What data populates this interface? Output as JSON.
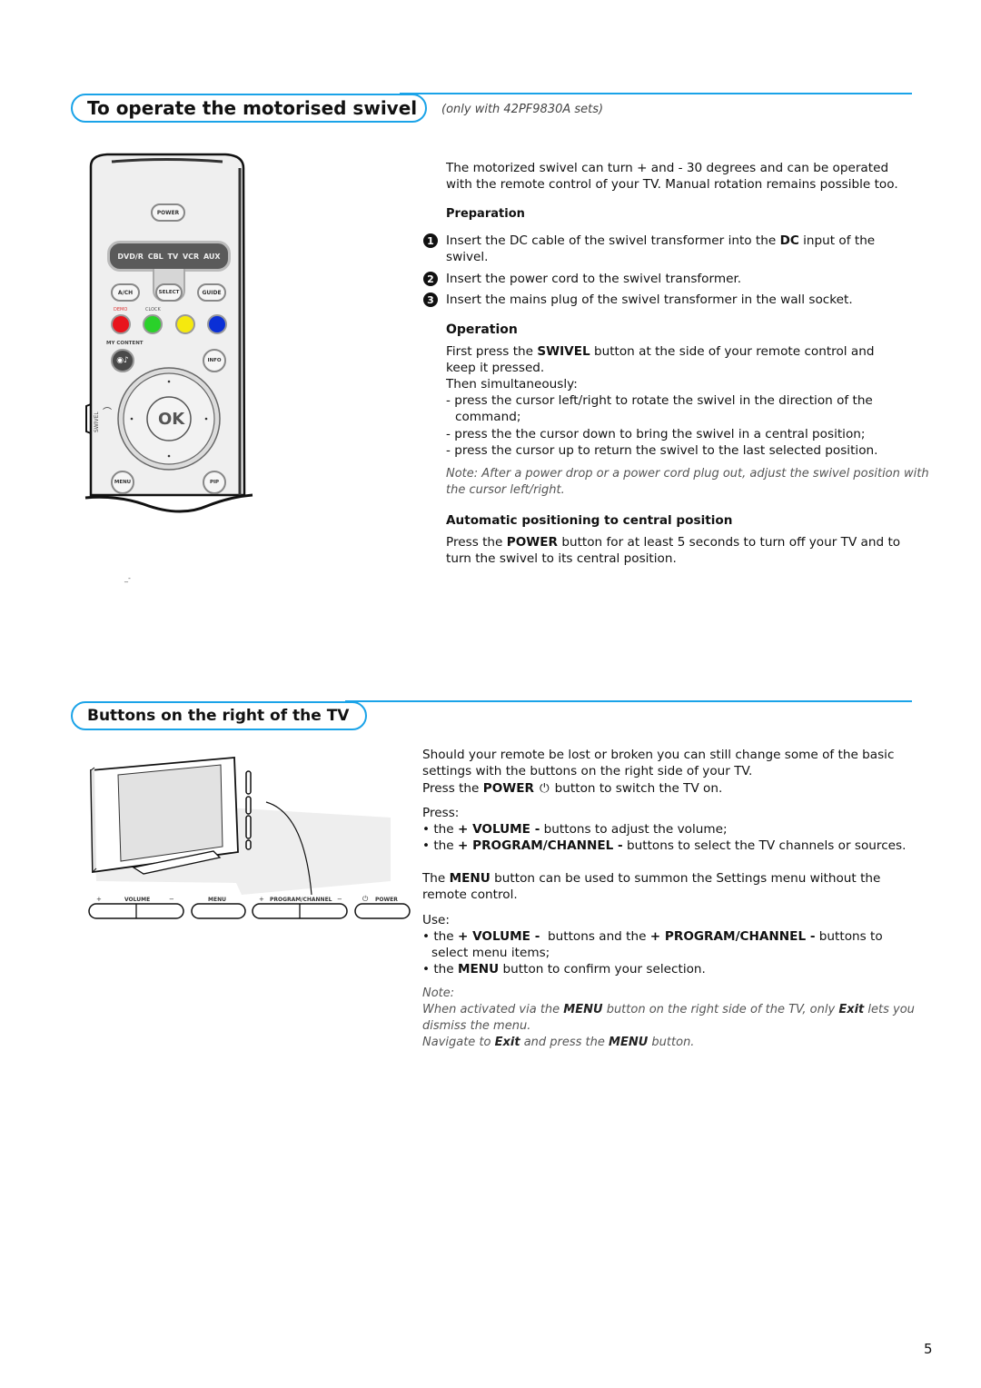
{
  "section1": {
    "title": "To operate the motorised swivel",
    "subtitle": "(only with 42PF9830A sets)",
    "intro_line1": "The motorized swivel can turn + and - 30 degrees and can be operated",
    "intro_line2": "with the remote control of your TV. Manual rotation remains possible too.",
    "preparation": {
      "heading": "Preparation",
      "steps": [
        {
          "num": "1",
          "line1_pre": "Insert the DC cable of the swivel transformer into the ",
          "line1_bold": "DC",
          "line1_post": " input of the",
          "line2": "swivel."
        },
        {
          "num": "2",
          "text": "Insert the power cord to the swivel transformer."
        },
        {
          "num": "3",
          "text": "Insert the mains plug of the swivel transformer in the wall socket."
        }
      ]
    },
    "operation": {
      "heading": "Operation",
      "p1_pre": "First press the ",
      "p1_bold": "SWIVEL",
      "p1_post": " button at the side of your remote control and",
      "p1_line2": "keep it pressed.",
      "p2": "Then simultaneously:",
      "bullets": [
        {
          "line1": "- press the cursor left/right to rotate the swivel in the direction of the",
          "line2": "command;"
        },
        {
          "line1": "- press the the cursor down to bring the swivel in a central position;"
        },
        {
          "line1": "- press the cursor up to return the swivel to the last selected position."
        }
      ],
      "note_line1": "Note: After a power drop or a power cord plug out, adjust the swivel position with",
      "note_line2": "the cursor left/right."
    },
    "auto": {
      "heading": "Automatic positioning to central position",
      "p_pre": "Press the ",
      "p_bold": "POWER",
      "p_post": " button for at least 5 seconds to turn off your TV and to",
      "p_line2": "turn the swivel to its central position."
    }
  },
  "remote": {
    "power": "POWER",
    "sources": [
      "DVD/R",
      "CBL",
      "TV",
      "VCR",
      "AUX"
    ],
    "ach": "A/CH",
    "select": "SELECT",
    "guide": "GUIDE",
    "demo": "DEMO",
    "clock": "CLOCK",
    "color_keys": [
      "#e8141c",
      "#2ad12a",
      "#f5e90e",
      "#0a2fd6"
    ],
    "my_content": "MY CONTENT",
    "info": "INFO",
    "ok": "OK",
    "swivel": "SWIVEL",
    "menu": "MENU",
    "pip": "PIP"
  },
  "section2": {
    "title": "Buttons on the right of the TV",
    "p1_line1": "Should your remote be lost or broken you can still change some of the basic",
    "p1_line2": "settings with the buttons on the right side of your TV.",
    "p1_line3_pre": "Press the ",
    "p1_line3_bold": "POWER",
    "p1_line3_post": " button to switch the TV on.",
    "press_label": "Press:",
    "press_bullets": [
      {
        "pre": "• the ",
        "bold": "+ VOLUME -",
        "post": " buttons to adjust the volume;"
      },
      {
        "pre": "• the ",
        "bold": "+ PROGRAM/CHANNEL -",
        "post": " buttons to select the TV channels or sources."
      }
    ],
    "menu_p_pre": "The ",
    "menu_p_bold": "MENU",
    "menu_p_post": " button can be used to summon the Settings menu without the",
    "menu_p_line2": "remote control.",
    "use_label": "Use:",
    "use_b1_pre": "• the ",
    "use_b1_bold1": "+ VOLUME -",
    "use_b1_mid": "  buttons and the ",
    "use_b1_bold2": "+ PROGRAM/CHANNEL -",
    "use_b1_post": " buttons to",
    "use_b1_line2": "select menu items;",
    "use_b2_pre": "• the ",
    "use_b2_bold": "MENU",
    "use_b2_post": " button to confirm your selection.",
    "note_label": "Note:",
    "note_l1_pre": "When activated via the ",
    "note_l1_b1": "MENU",
    "note_l1_mid": " button on the right side of the TV, only ",
    "note_l1_b2": "Exit",
    "note_l1_post": " lets you",
    "note_l2": "dismiss the menu.",
    "note_l3_pre": "Navigate to ",
    "note_l3_b1": "Exit",
    "note_l3_mid": " and press the ",
    "note_l3_b2": "MENU",
    "note_l3_post": " button.",
    "tv_buttons": {
      "plus1": "+",
      "volume": "VOLUME",
      "minus1": "−",
      "menu": "MENU",
      "plus2": "+",
      "program": "PROGRAM/CHANNEL",
      "minus2": "−",
      "power": "POWER"
    }
  },
  "page_number": "5"
}
